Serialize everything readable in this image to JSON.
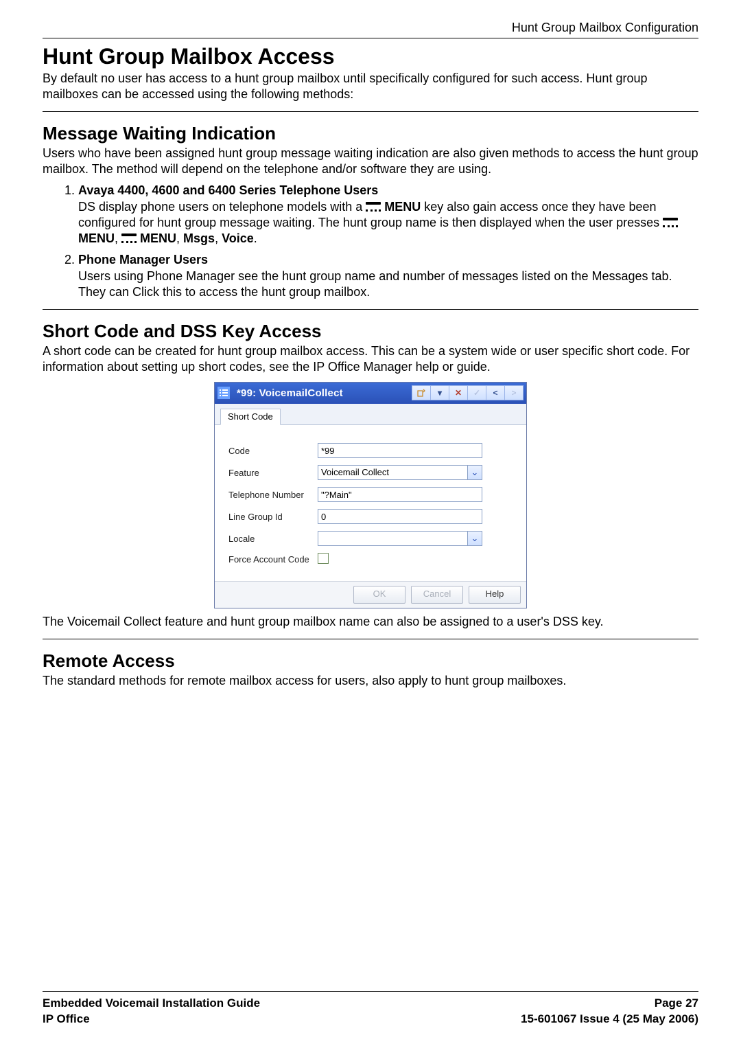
{
  "header_right": "Hunt Group Mailbox Configuration",
  "h1": "Hunt Group Mailbox Access",
  "p1": "By default no user has access to a hunt group mailbox until specifically configured for such access. Hunt group mailboxes can be accessed using the following methods:",
  "h2a": "Message Waiting Indication",
  "p2": "Users who have been assigned hunt group message waiting indication are also given methods to access the hunt group mailbox. The method will depend on the telephone and/or software they are using.",
  "li1_title": "Avaya 4400, 4600 and 6400 Series Telephone Users",
  "li1_pre": "DS display phone users on telephone models with a ",
  "li1_menu1": "MENU",
  "li1_mid": " key also gain access once they have been configured for hunt group message waiting. The hunt group name is then displayed when the user presses ",
  "li1_seq_menu": "MENU",
  "li1_seq_menu2": "MENU",
  "li1_seq_msgs": "Msgs",
  "li1_seq_voice": "Voice",
  "li2_title": "Phone Manager Users",
  "li2_body": "Users using Phone Manager see the hunt group name and number of messages listed on the Messages tab. They can Click this to access the hunt group mailbox.",
  "h2b": "Short Code and DSS Key Access",
  "p3": "A short code can be created for hunt group mailbox access. This can be a system wide or user specific short code. For information about setting up short codes, see the IP Office Manager help or guide.",
  "dialog": {
    "title": "*99: VoicemailCollect",
    "tab": "Short Code",
    "labels": {
      "code": "Code",
      "feature": "Feature",
      "tel": "Telephone Number",
      "lgid": "Line Group Id",
      "locale": "Locale",
      "force": "Force Account Code"
    },
    "values": {
      "code": "*99",
      "feature": "Voicemail Collect",
      "tel": "\"?Main\"",
      "lgid": "0",
      "locale": ""
    },
    "buttons": {
      "ok": "OK",
      "cancel": "Cancel",
      "help": "Help"
    }
  },
  "p4": "The Voicemail Collect feature and hunt group mailbox name can also be assigned to a user's DSS key.",
  "h2c": "Remote Access",
  "p5": "The standard methods for remote mailbox access for users, also apply to hunt group mailboxes.",
  "footer": {
    "left1": "Embedded Voicemail Installation Guide",
    "left2": "IP Office",
    "right1": "Page 27",
    "right2": "15-601067 Issue 4 (25 May 2006)"
  }
}
